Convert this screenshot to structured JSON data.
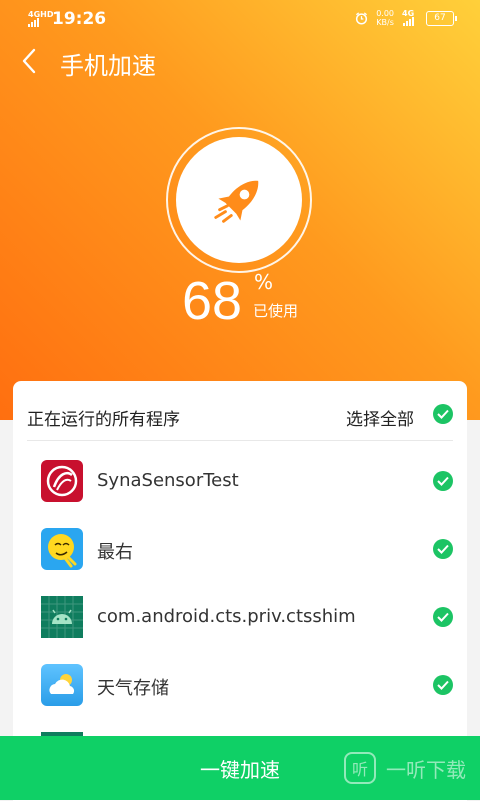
{
  "status_bar": {
    "network": "4GHD",
    "time": "19:26",
    "speed_value": "0.00",
    "speed_unit": "KB/s",
    "signal_label": "4G",
    "battery": "67"
  },
  "header": {
    "title": "手机加速",
    "back_icon": "chevron-left-icon"
  },
  "gauge": {
    "icon": "rocket-icon",
    "value": "68",
    "percent_sign": "%",
    "label": "已使用"
  },
  "list": {
    "title": "正在运行的所有程序",
    "select_all": "选择全部",
    "apps": [
      {
        "name": "SynaSensorTest",
        "icon": "synasensor-app-icon",
        "selected": true
      },
      {
        "name": "最右",
        "icon": "zuiyou-app-icon",
        "selected": true
      },
      {
        "name": "com.android.cts.priv.ctsshim",
        "icon": "android-app-icon",
        "selected": true
      },
      {
        "name": "天气存储",
        "icon": "weather-app-icon",
        "selected": true
      }
    ]
  },
  "action": {
    "boost_label": "一键加速"
  },
  "watermark": {
    "logo": "听",
    "text": "一听下载"
  },
  "colors": {
    "accent_orange": "#ff8a1a",
    "accent_green": "#0fd066",
    "check_green": "#1cc464"
  }
}
